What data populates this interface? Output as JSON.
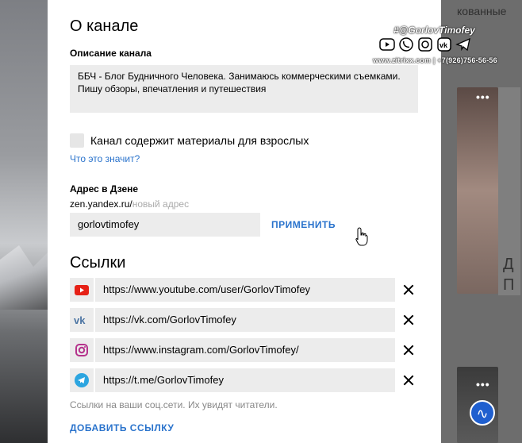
{
  "background": {
    "right_tab_text": "кованные",
    "right_card_letters": "Д\nП",
    "dots": "•••"
  },
  "about": {
    "title": "О канале",
    "description_label": "Описание канала",
    "description_value": "ББЧ - Блог Будничного Человека. Занимаюсь коммерческими съемками. Пишу обзоры, впечатления и путешествия",
    "adult_checkbox_label": "Канал содержит материалы для взрослых",
    "adult_checked": false,
    "what_means_link": "Что это значит?"
  },
  "address": {
    "label": "Адрес в Дзене",
    "prefix": "zen.yandex.ru/",
    "placeholder": "новый адрес",
    "value": "gorlovtimofey",
    "apply_label": "ПРИМЕНИТЬ"
  },
  "links": {
    "title": "Ссылки",
    "items": [
      {
        "icon": "youtube-icon",
        "url": "https://www.youtube.com/user/GorlovTimofey"
      },
      {
        "icon": "vk-icon",
        "url": "https://vk.com/GorlovTimofey"
      },
      {
        "icon": "instagram-icon",
        "url": "https://www.instagram.com/GorlovTimofey/"
      },
      {
        "icon": "telegram-icon",
        "url": "https://t.me/GorlovTimofey"
      }
    ],
    "hint": "Ссылки на ваши соц.сети. Их увидят читатели.",
    "add_label": "ДОБАВИТЬ ССЫЛКУ"
  },
  "watermark": {
    "handle": "#@GorlovTimofey",
    "footer": "www.zitrixx.com | +7(926)756-56-56",
    "icons": [
      "youtube-icon",
      "whatsapp-icon",
      "instagram-icon",
      "vk-icon",
      "telegram-icon"
    ]
  },
  "colors": {
    "accent": "#2a73cc",
    "field_bg": "#ececec",
    "youtube": "#e62117",
    "vk": "#4c75a3",
    "telegram": "#2ca5e0"
  }
}
